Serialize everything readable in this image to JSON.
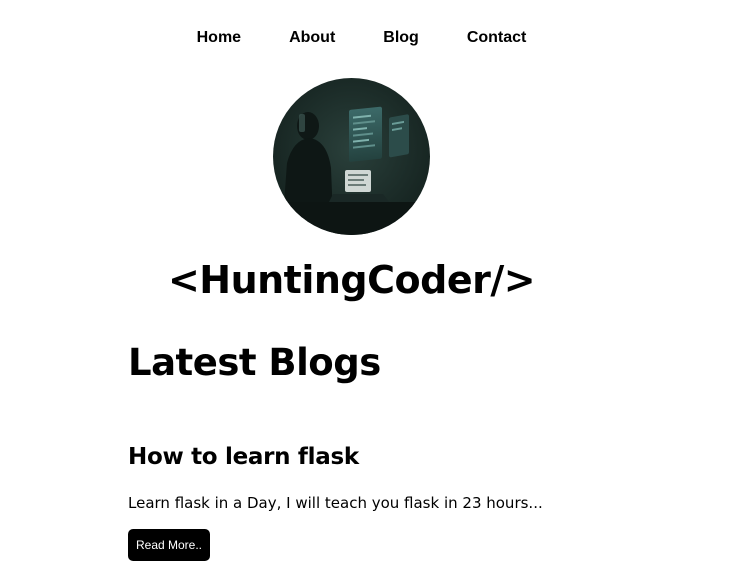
{
  "nav": {
    "items": [
      {
        "label": "Home"
      },
      {
        "label": "About"
      },
      {
        "label": "Blog"
      },
      {
        "label": "Contact"
      }
    ]
  },
  "hero": {
    "image_desc": "coder-at-monitors-image",
    "title": "<HuntingCoder/>"
  },
  "blogs": {
    "heading": "Latest Blogs",
    "posts": [
      {
        "title": "How to learn flask",
        "excerpt": "Learn flask in a Day, I will teach you flask in 23 hours...",
        "button_label": "Read More.."
      }
    ]
  },
  "colors": {
    "background": "#ffffff",
    "text": "#000000",
    "button_bg": "#000000",
    "button_text": "#ffffff",
    "image_tone": "#1d2e2a"
  }
}
